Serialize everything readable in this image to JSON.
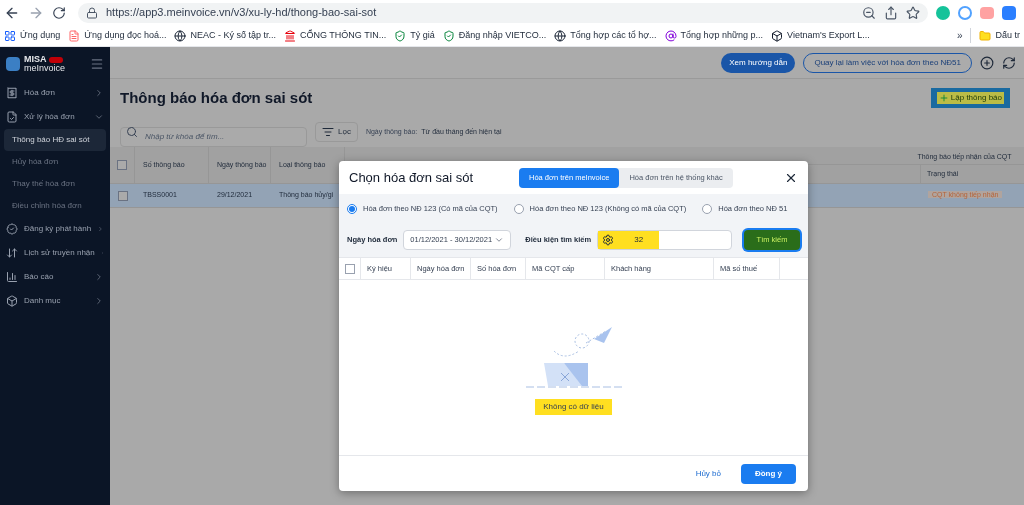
{
  "browser": {
    "url": "https://app3.meinvoice.vn/v3/xu-ly-hd/thong-bao-sai-sot",
    "bookmarks": [
      {
        "kind": "apps",
        "label": "Ứng dụng"
      },
      {
        "kind": "file",
        "label": "Ứng dụng đọc hoá..."
      },
      {
        "kind": "globe",
        "label": "NEAC - Ký số tập tr..."
      },
      {
        "kind": "emblem",
        "label": "CỔNG THÔNG TIN..."
      },
      {
        "kind": "shield",
        "label": "Tỷ giá"
      },
      {
        "kind": "shield",
        "label": "Đăng nhập VIETCO..."
      },
      {
        "kind": "globe",
        "label": "Tổng hợp các tổ hợ..."
      },
      {
        "kind": "at",
        "label": "Tổng hợp những p..."
      },
      {
        "kind": "logo",
        "label": "Vietnam's Export L..."
      }
    ],
    "overflow": "»",
    "folder": "Dấu tr"
  },
  "sidebar": {
    "logo_top": "MISA",
    "logo_bottom": "meInvoice",
    "items": [
      {
        "label": "Hóa đơn",
        "expanded": false
      },
      {
        "label": "Xử lý hóa đơn",
        "expanded": true,
        "children": [
          {
            "label": "Thông báo HĐ sai sót",
            "selected": true
          },
          {
            "label": "Hủy hóa đơn",
            "selected": false
          },
          {
            "label": "Thay thế hóa đơn",
            "selected": false
          },
          {
            "label": "Điều chỉnh hóa đơn",
            "selected": false
          }
        ]
      },
      {
        "label": "Đăng ký phát hành",
        "expanded": false
      },
      {
        "label": "Lịch sử truyền nhận",
        "expanded": false
      },
      {
        "label": "Báo cáo",
        "expanded": false
      },
      {
        "label": "Danh mục",
        "expanded": false
      }
    ]
  },
  "header": {
    "guide_button": "Xem hướng dẫn",
    "back_button": "Quay lại làm việc với hóa đơn theo NĐ51"
  },
  "page": {
    "title": "Thông báo hóa đơn sai sót",
    "create_button": "Lập thông báo",
    "search_placeholder": "Nhập từ khóa để tìm...",
    "filter_button": "Lọc",
    "date_filter_label": "Ngày thông báo:",
    "date_filter_value": "Từ đầu tháng đến hiện tại"
  },
  "table": {
    "all_checked": false,
    "group_header": "Thông báo tiếp nhận của CQT",
    "columns": [
      "Số thông báo",
      "Ngày thông báo",
      "Loại thông báo",
      "Trạng thái"
    ],
    "rows": [
      {
        "checked": false,
        "selected": true,
        "cells": [
          "TBSS0001",
          "29/12/2021",
          "Thông báo hủy/gi"
        ],
        "status": "CQT không tiếp nhận"
      }
    ]
  },
  "dialog": {
    "title": "Chọn hóa đơn sai sót",
    "tabs": [
      {
        "label": "Hóa đơn trên meInvoice",
        "selected": true
      },
      {
        "label": "Hóa đơn trên hệ thống khác",
        "selected": false
      }
    ],
    "radios": [
      {
        "label": "Hóa đơn theo NĐ 123 (Có mã của CQT)",
        "selected": true
      },
      {
        "label": "Hóa đơn theo NĐ 123 (Không có mã của CQT)",
        "selected": false
      },
      {
        "label": "Hóa đơn theo NĐ 51",
        "selected": false
      }
    ],
    "date_label": "Ngày hóa đơn",
    "date_value": "01/12/2021 - 30/12/2021",
    "condition_label": "Điều kiện tìm kiếm",
    "condition_value": "32",
    "search_button": "Tìm kiếm",
    "all_checked": false,
    "columns": [
      "Ký hiệu",
      "Ngày hóa đơn",
      "Số hóa đơn",
      "Mã CQT cấp",
      "Khách hàng",
      "Mã số thuế"
    ],
    "empty_text": "Không có dữ liệu",
    "cancel_button": "Hủy bỏ",
    "ok_button": "Đồng ý"
  }
}
